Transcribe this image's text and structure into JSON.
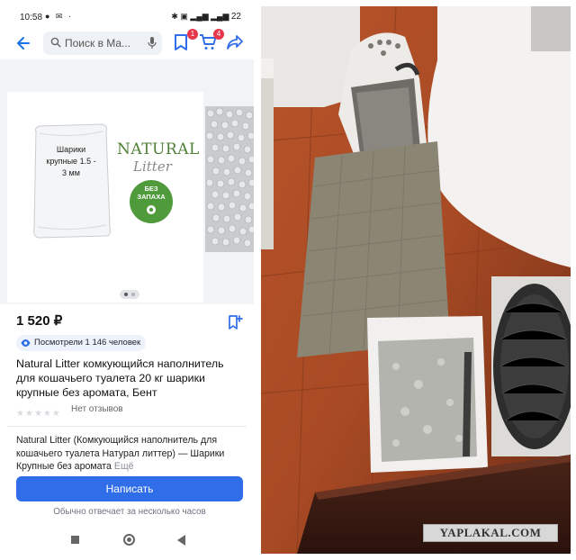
{
  "status_bar": {
    "time": "10:58",
    "left_icons": "● ✉ ·",
    "right_icons": "✱ ▣ ▂▄▆ ▂▄▆",
    "battery": "22"
  },
  "top_bar": {
    "search_placeholder": "Поиск в Ма...",
    "favorites_badge": "1",
    "cart_badge": "4",
    "icons": [
      "back-arrow-icon",
      "search-icon",
      "mic-icon",
      "bookmark-icon",
      "cart-icon",
      "share-icon"
    ]
  },
  "gallery": {
    "bag_label": "Шарики крупные 1.5 - 3 мм",
    "brand_line1": "NATURAL",
    "brand_line2": "Litter",
    "seal_text": "БЕЗ ЗАПАХА",
    "image_count": 2,
    "active_image": 1
  },
  "product": {
    "price": "1 520 ₽",
    "views": "Посмотрели 1 146 человек",
    "title": "Natural Litter комкующийся наполнитель для кошачьего туалета 20 кг шарики крупные  без аромата, Бент",
    "rating_stars": 0,
    "reviews": "Нет отзывов",
    "description": "Natural Litter (Комкующийся наполнитель для кошачьего туалета Натурал литтер) — Шарики Крупные без аромата",
    "description_more": "Ещё"
  },
  "actions": {
    "write_button": "Написать",
    "reply_note": "Обычно отвечает за несколько часов"
  },
  "photo": {
    "watermark": "YAPLAKAL.COM"
  },
  "colors": {
    "accent": "#2f6ee8",
    "badge": "#e8374b",
    "brand_green": "#4f7f37"
  }
}
